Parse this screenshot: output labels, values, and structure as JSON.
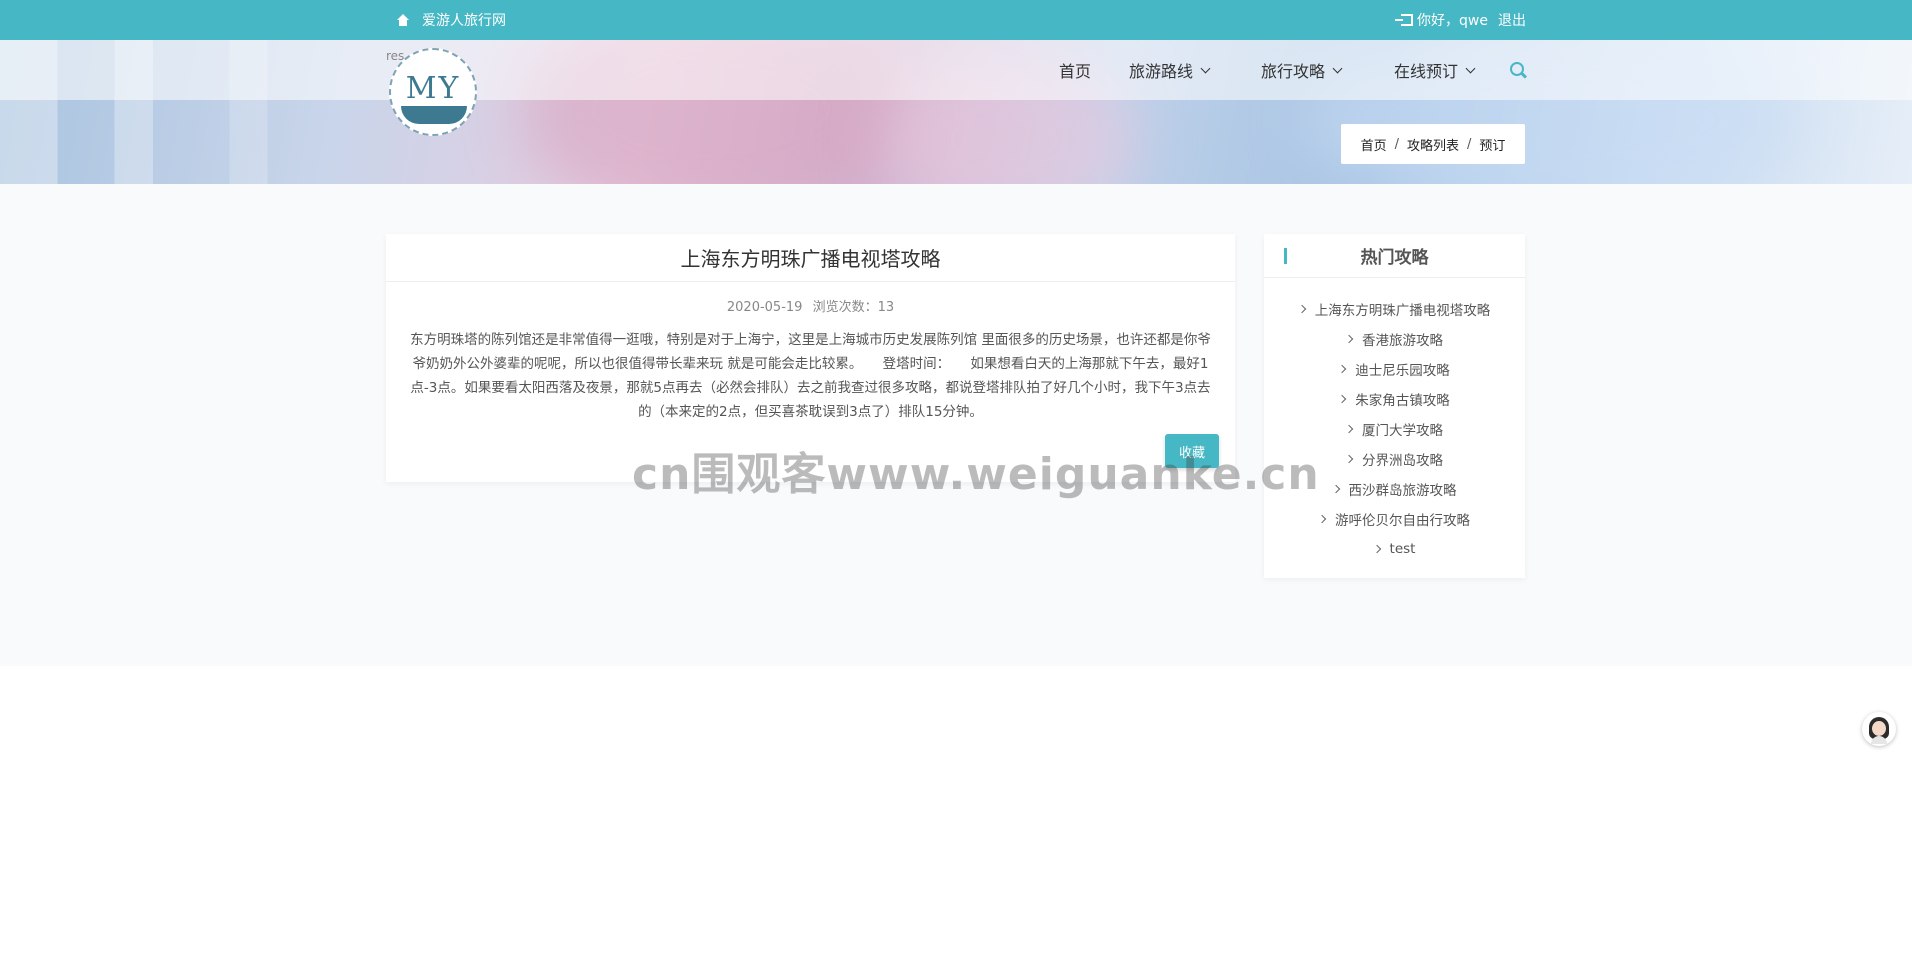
{
  "topbar": {
    "site_name": "爱游人旅行网",
    "greeting": "你好，qwe",
    "logout": "退出"
  },
  "logo": {
    "alt_text": "res",
    "text": "MY"
  },
  "nav": {
    "items": [
      "首页",
      "旅游路线",
      "旅行攻略",
      "在线预订"
    ]
  },
  "breadcrumb": {
    "items": [
      "首页",
      "攻略列表",
      "预订"
    ],
    "separator": "/"
  },
  "article": {
    "title": "上海东方明珠广播电视塔攻略",
    "date": "2020-05-19",
    "views": "浏览次数：13",
    "body": "东方明珠塔的陈列馆还是非常值得一逛哦，特别是对于上海宁，这里是上海城市历史发展陈列馆 里面很多的历史场景，也许还都是你爷爷奶奶外公外婆辈的呢呢，所以也很值得带长辈来玩 就是可能会走比较累。　　登塔时间：　　如果想看白天的上海那就下午去，最好1点-3点。如果要看太阳西落及夜景，那就5点再去（必然会排队）去之前我查过很多攻略，都说登塔排队拍了好几个小时，我下午3点去的（本来定的2点，但买喜茶耽误到3点了）排队15分钟。",
    "favorite_button": "收藏"
  },
  "watermark": "cn围观客www.weiguanke.cn",
  "sidebar": {
    "title": "热门攻略",
    "items": [
      "上海东方明珠广播电视塔攻略",
      "香港旅游攻略",
      "迪士尼乐园攻略",
      "朱家角古镇攻略",
      "厦门大学攻略",
      "分界洲岛攻略",
      "西沙群岛旅游攻略",
      "游呼伦贝尔自由行攻略",
      "test"
    ]
  },
  "colors": {
    "accent": "#46b7c4",
    "page_bg": "#f8fafc"
  }
}
